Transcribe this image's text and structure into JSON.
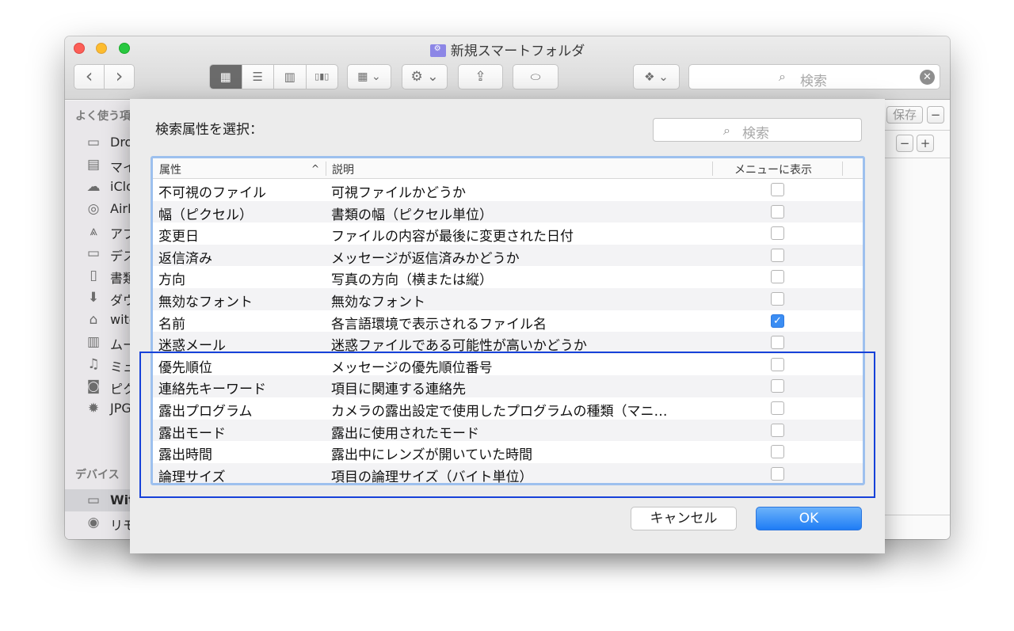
{
  "window": {
    "title": "新規スマートフォルダ",
    "search_placeholder": "検索",
    "clear_symbol": "✕",
    "view_icons": [
      "▦",
      "☰",
      "▥",
      "▯▮▯"
    ],
    "arrange_icon": "▦ ⌄",
    "action_icon": "⚙ ⌄",
    "share_icon": "⇪",
    "tag_icon": "⬭",
    "dropbox_icon": "❖ ⌄",
    "nav_back": "‹",
    "nav_forward": "›"
  },
  "sidebar": {
    "favorites_header": "よく使う項目",
    "devices_header": "デバイス",
    "items": [
      {
        "icon": "▭",
        "label": "Dropbox"
      },
      {
        "icon": "▤",
        "label": "マイファイル"
      },
      {
        "icon": "☁",
        "label": "iCloud Drive"
      },
      {
        "icon": "◎",
        "label": "AirDrop"
      },
      {
        "icon": "⩓",
        "label": "アプリケーション"
      },
      {
        "icon": "▭",
        "label": "デスクトップ"
      },
      {
        "icon": "▯",
        "label": "書類"
      },
      {
        "icon": "⬇",
        "label": "ダウンロード"
      },
      {
        "icon": "⌂",
        "label": "witch"
      },
      {
        "icon": "▥",
        "label": "ムービー"
      },
      {
        "icon": "♫",
        "label": "ミュージック"
      },
      {
        "icon": "◙",
        "label": "ピクチャ"
      },
      {
        "icon": "✹",
        "label": "JPG"
      }
    ],
    "devices": [
      {
        "icon": "▭",
        "label": "Witch"
      },
      {
        "icon": "◉",
        "label": "リモートディスク"
      }
    ]
  },
  "right_pane": {
    "save_label": "保存",
    "minus": "−",
    "plus": "+"
  },
  "dialog": {
    "title": "検索属性を選択：",
    "search_placeholder": "検索",
    "columns": {
      "attribute": "属性",
      "description": "説明",
      "show_in_menu": "メニューに表示",
      "sort_indicator": "^"
    },
    "rows": [
      {
        "attribute": "不可視のファイル",
        "description": "可視ファイルかどうか",
        "checked": false
      },
      {
        "attribute": "幅（ピクセル）",
        "description": "書類の幅（ピクセル単位）",
        "checked": false
      },
      {
        "attribute": "変更日",
        "description": "ファイルの内容が最後に変更された日付",
        "checked": false
      },
      {
        "attribute": "返信済み",
        "description": "メッセージが返信済みかどうか",
        "checked": false
      },
      {
        "attribute": "方向",
        "description": "写真の方向（横または縦）",
        "checked": false
      },
      {
        "attribute": "無効なフォント",
        "description": "無効なフォント",
        "checked": false
      },
      {
        "attribute": "名前",
        "description": "各言語環境で表示されるファイル名",
        "checked": true
      },
      {
        "attribute": "迷惑メール",
        "description": "迷惑ファイルである可能性が高いかどうか",
        "checked": false
      },
      {
        "attribute": "優先順位",
        "description": "メッセージの優先順位番号",
        "checked": false
      },
      {
        "attribute": "連絡先キーワード",
        "description": "項目に関連する連絡先",
        "checked": false
      },
      {
        "attribute": "露出プログラム",
        "description": "カメラの露出設定で使用したプログラムの種類（マニ…",
        "checked": false
      },
      {
        "attribute": "露出モード",
        "description": "露出に使用されたモード",
        "checked": false
      },
      {
        "attribute": "露出時間",
        "description": "露出中にレンズが開いていた時間",
        "checked": false
      },
      {
        "attribute": "論理サイズ",
        "description": "項目の論理サイズ（バイト単位）",
        "checked": false
      }
    ],
    "checkmark": "✓",
    "cancel_label": "キャンセル",
    "ok_label": "OK"
  },
  "colors": {
    "accent": "#1e7cf5",
    "highlight_box": "#1641d9",
    "table_focus_ring": "#9dc0ee"
  }
}
